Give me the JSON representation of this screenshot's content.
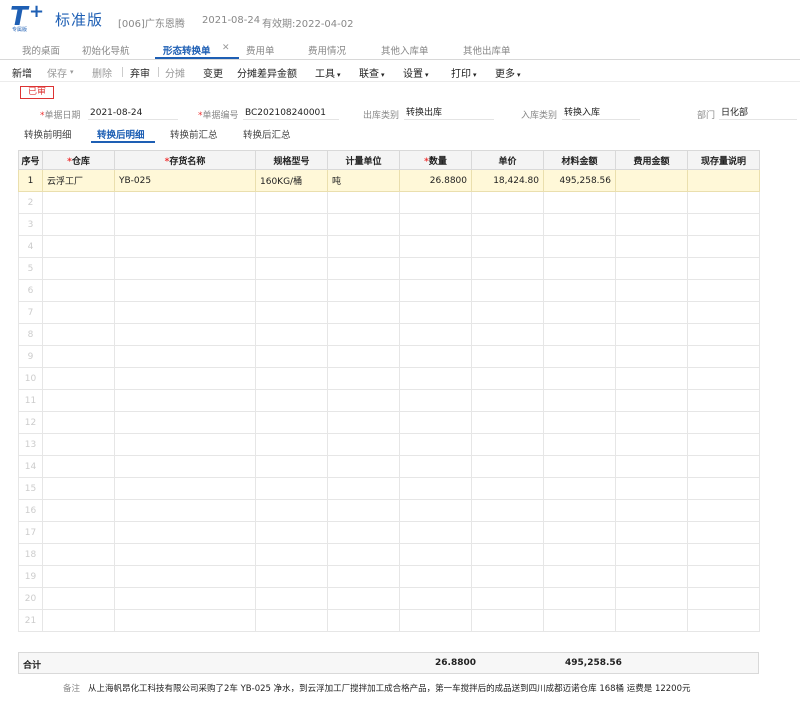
{
  "app": {
    "logo_letter": "T",
    "logo_plus": "+",
    "logo_sub": "专属版",
    "edition": "标准版",
    "company": "[006]广东恩腾",
    "current_date": "2021-08-24",
    "validity": "有效期:2022-04-02",
    "brand_color": "#1e5fb4"
  },
  "tabs": [
    {
      "label": "我的桌面"
    },
    {
      "label": "初始化导航"
    },
    {
      "label": "形态转换单",
      "active": true
    },
    {
      "label": "费用单"
    },
    {
      "label": "费用情况"
    },
    {
      "label": "其他入库单"
    },
    {
      "label": "其他出库单"
    }
  ],
  "toolbar": {
    "new": "新增",
    "save": "保存",
    "delete": "删除",
    "abandon": "弃审",
    "split": "分摊",
    "change": "变更",
    "split_diff": "分摊差异金额",
    "tools": "工具",
    "link": "联查",
    "settings": "设置",
    "print": "打印",
    "more": "更多"
  },
  "status_stamp": "已审",
  "header": {
    "date_label": "单据日期",
    "date_value": "2021-08-24",
    "code_label": "单据编号",
    "code_value": "BC202108240001",
    "out_type_label": "出库类别",
    "out_type_value": "转换出库",
    "in_type_label": "入库类别",
    "in_type_value": "转换入库",
    "dept_label": "部门",
    "dept_value": "日化部"
  },
  "subtabs": [
    {
      "label": "转换前明细"
    },
    {
      "label": "转换后明细",
      "active": true
    },
    {
      "label": "转换前汇总"
    },
    {
      "label": "转换后汇总"
    }
  ],
  "table": {
    "columns": [
      "序号",
      "仓库",
      "存货名称",
      "规格型号",
      "计量单位",
      "数量",
      "单价",
      "材料金额",
      "费用金额",
      "现存量说明"
    ],
    "required_columns": [
      1,
      2,
      5
    ],
    "rows": [
      {
        "idx": "1",
        "warehouse": "云浮工厂",
        "item": "YB-025",
        "spec": "160KG/桶",
        "unit": "吨",
        "qty": "26.8800",
        "price": "18,424.80",
        "amount": "495,258.56",
        "fee": "",
        "note": ""
      }
    ],
    "empty_row_numbers": [
      "2",
      "3",
      "4",
      "5",
      "6",
      "7",
      "8",
      "9",
      "10",
      "11",
      "12",
      "13",
      "14",
      "15",
      "16",
      "17",
      "18",
      "19",
      "20",
      "21"
    ]
  },
  "totals": {
    "label": "合计",
    "qty": "26.8800",
    "amount": "495,258.56"
  },
  "remark": {
    "label": "备注",
    "text": "从上海帆昂化工科技有限公司采购了2车 YB-025 净水，到云浮加工厂搅拌加工成合格产品，第一车搅拌后的成品送到四川成都迈诺仓库  168桶  运费是 12200元"
  }
}
